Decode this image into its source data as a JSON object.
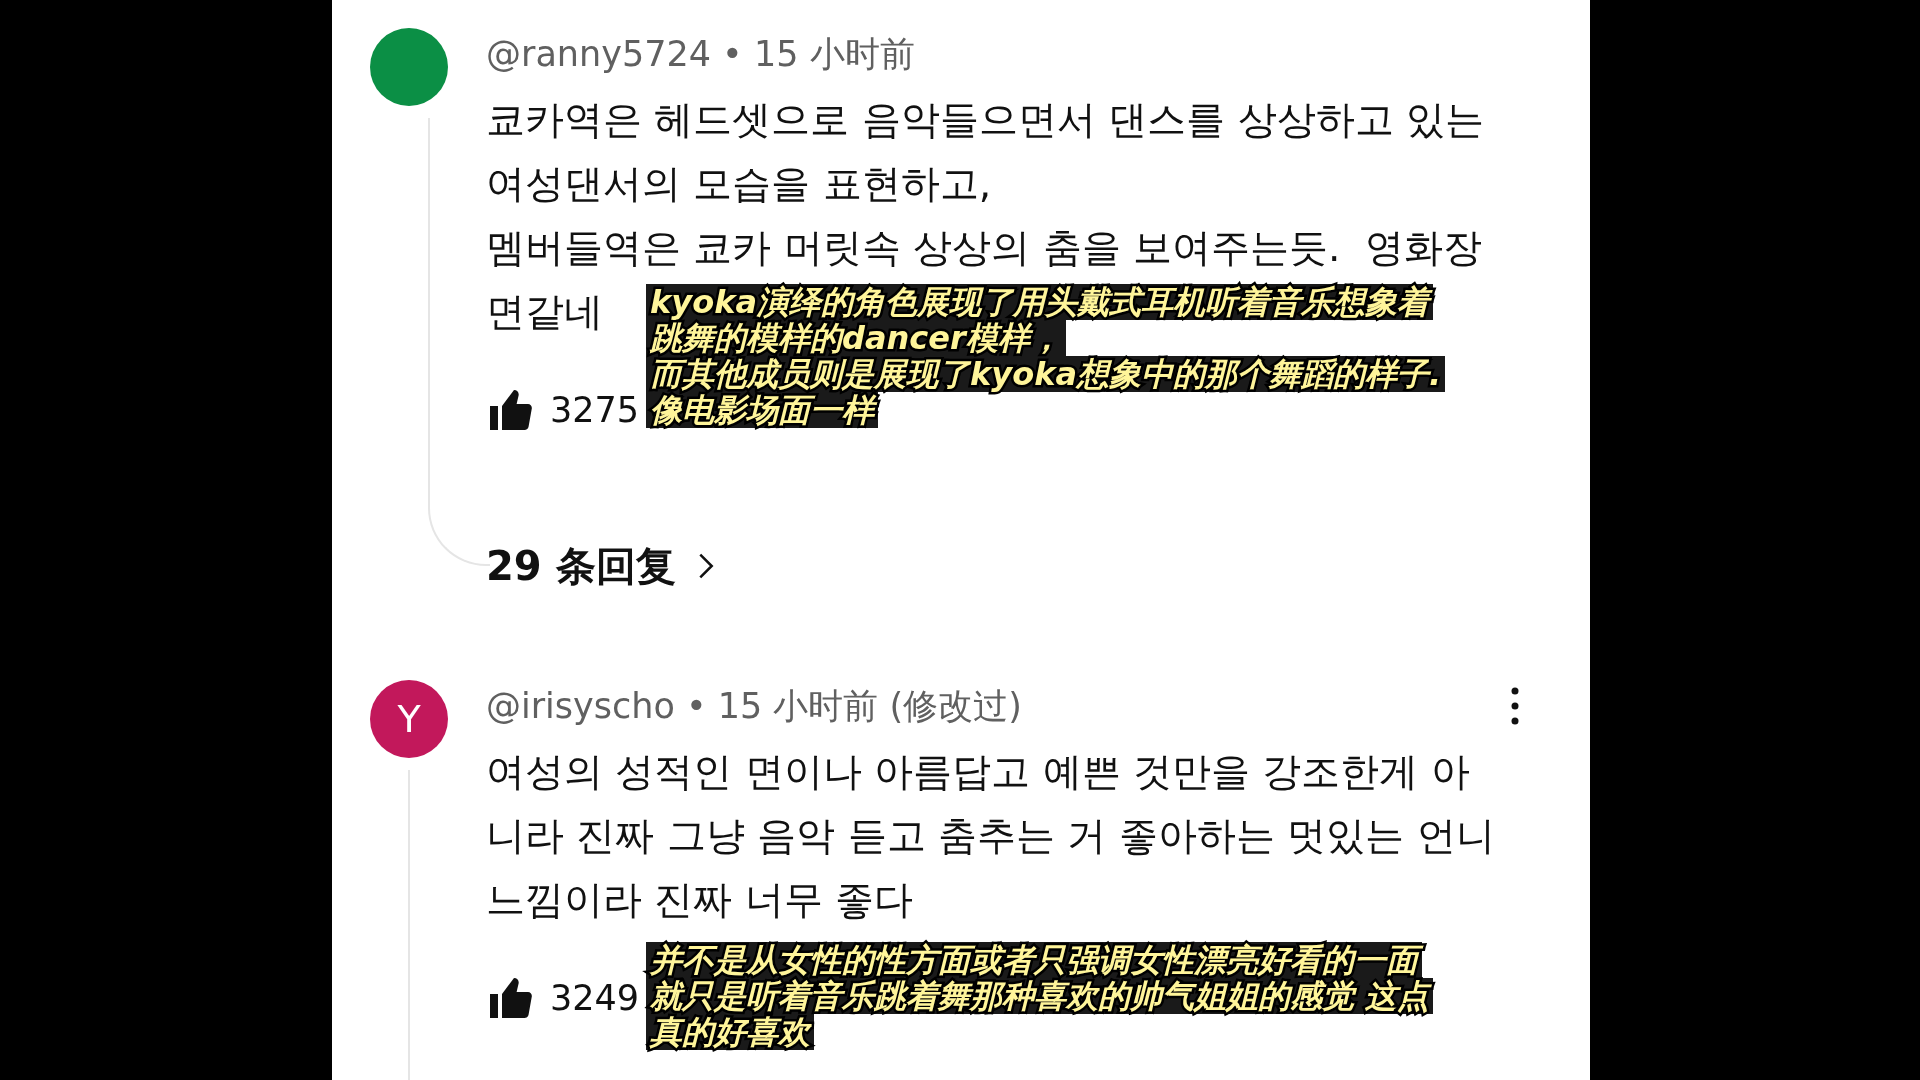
{
  "comments": [
    {
      "avatar": {
        "color": "#0b8f45"
      },
      "author": "@ranny5724",
      "separator": "•",
      "time": "15 小时前",
      "more_menu": false,
      "lines": [
        "쿄카역은 헤드셋으로 음악들으면서 댄스를 상상하고 있는",
        "여성댄서의 모습을 표현하고,",
        "멤버들역은 쿄카 머릿속 상상의 춤을 보여주는듯.  영화장",
        "면같네"
      ],
      "likes": "3275",
      "replies": "29 条回复",
      "caption": [
        "kyoka演绎的角色展现了用头戴式耳机听着音乐想象着",
        "跳舞的模样的dancer模样，",
        "而其他成员则是展现了kyoka想象中的那个舞蹈的样子.",
        "像电影场面一样"
      ]
    },
    {
      "avatar": {
        "letter": "Y",
        "color": "#c2185b"
      },
      "author": "@irisyscho",
      "separator": "•",
      "time": "15 小时前",
      "edited": "(修改过)",
      "more_menu": true,
      "lines": [
        "여성의 성적인 면이나 아름답고 예쁜 것만을 강조한게 아",
        "니라 진짜 그냥 음악 듣고 춤추는 거 좋아하는 멋있는 언니",
        "느낌이라 진짜 너무 좋다"
      ],
      "likes": "3249",
      "caption": [
        "并不是从女性的性方面或者只强调女性漂亮好看的一面",
        "就只是听着音乐跳着舞那种喜欢的帅气姐姐的感觉 这点",
        "真的好喜欢"
      ]
    }
  ]
}
